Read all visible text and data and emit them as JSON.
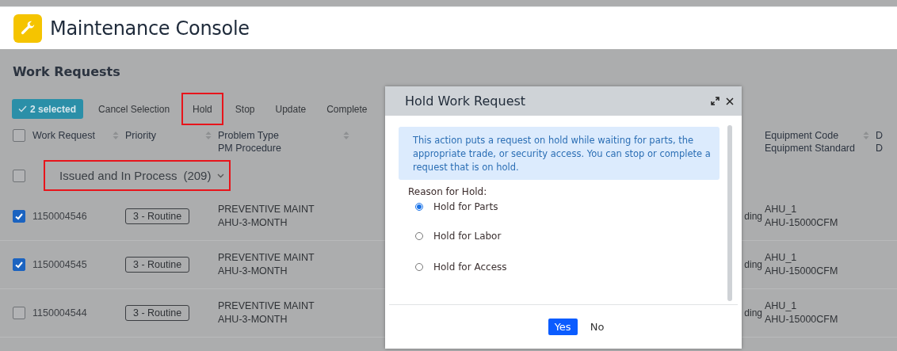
{
  "app_header": {
    "title": "Maintenance Console"
  },
  "page": {
    "title": "Work Requests"
  },
  "toolbar": {
    "selection": "2 selected",
    "actions": [
      {
        "label": "Cancel Selection",
        "highlighted": false
      },
      {
        "label": "Hold",
        "highlighted": true
      },
      {
        "label": "Stop",
        "highlighted": false
      },
      {
        "label": "Update",
        "highlighted": false
      },
      {
        "label": "Complete",
        "highlighted": false
      }
    ]
  },
  "table": {
    "select_all_checked": false,
    "columns": [
      {
        "lines": [
          "Work Request"
        ],
        "sortable": true
      },
      {
        "lines": [
          "Priority"
        ],
        "sortable": true
      },
      {
        "lines": [
          "Problem Type",
          "PM Procedure"
        ],
        "sortable": true
      },
      {
        "lines": [
          "Equipment Code",
          "Equipment Standard"
        ],
        "sortable": true
      },
      {
        "lines": [
          "D",
          "D"
        ],
        "sortable": false
      }
    ],
    "group": {
      "label": "Issued and In Process",
      "count": "(209)",
      "checked": false,
      "highlighted": true
    },
    "rows": [
      {
        "checked": true,
        "work_request": "1150004546",
        "priority": "3 - Routine",
        "problem_type": "PREVENTIVE MAINT",
        "pm_procedure": "AHU-3-MONTH",
        "column_4": "ding",
        "equipment_code": "AHU_1",
        "equipment_standard": "AHU-15000CFM"
      },
      {
        "checked": true,
        "work_request": "1150004545",
        "priority": "3 - Routine",
        "problem_type": "PREVENTIVE MAINT",
        "pm_procedure": "AHU-3-MONTH",
        "column_4": "ding",
        "equipment_code": "AHU_1",
        "equipment_standard": "AHU-15000CFM"
      },
      {
        "checked": false,
        "work_request": "1150004544",
        "priority": "3 - Routine",
        "problem_type": "PREVENTIVE MAINT",
        "pm_procedure": "AHU-3-MONTH",
        "column_4": "ding",
        "equipment_code": "AHU_1",
        "equipment_standard": "AHU-15000CFM"
      }
    ]
  },
  "dialog": {
    "title": "Hold Work Request",
    "info": "This action puts a request on hold while waiting for parts, the appropriate trade, or security access. You can stop or complete a request that is on hold.",
    "reason_label": "Reason for Hold:",
    "options": [
      {
        "label": "Hold for Parts",
        "selected": true
      },
      {
        "label": "Hold for Labor",
        "selected": false
      },
      {
        "label": "Hold for Access",
        "selected": false
      }
    ],
    "buttons": [
      {
        "label": "Yes",
        "kind": "primary"
      },
      {
        "label": "No",
        "kind": "plain"
      }
    ]
  }
}
